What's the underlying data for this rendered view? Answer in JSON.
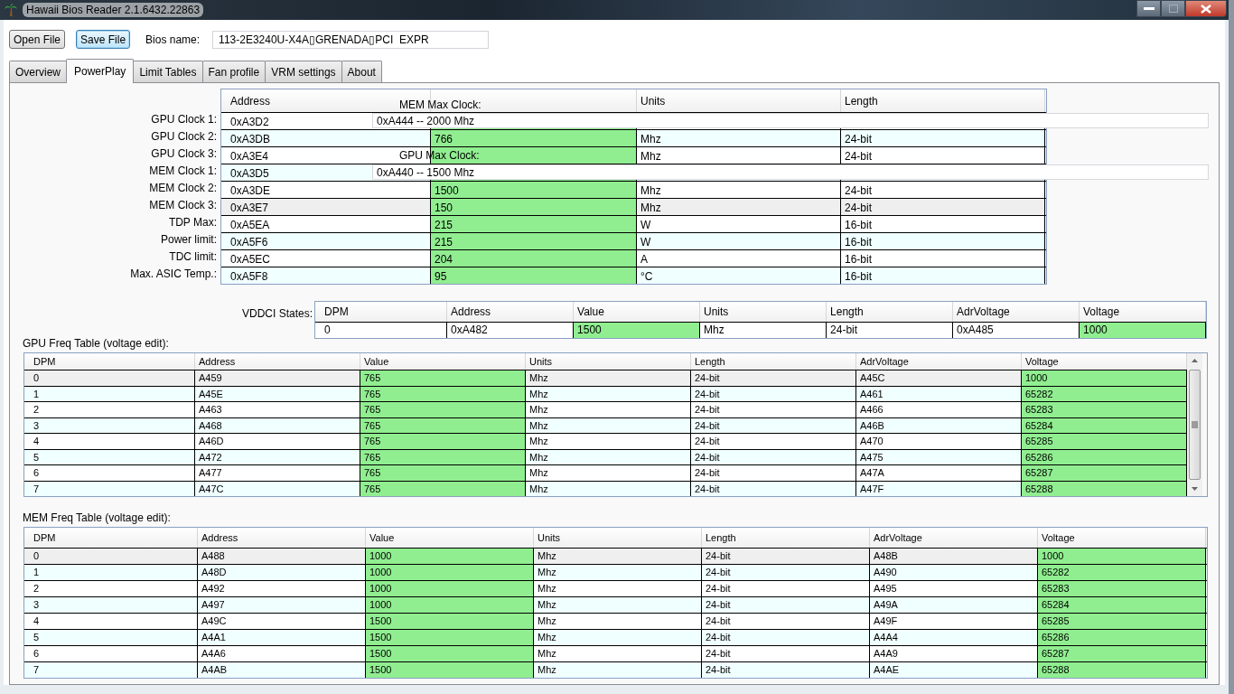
{
  "window": {
    "title": "Hawaii Bios Reader 2.1.6432.22863"
  },
  "toolbar": {
    "buttons": [
      {
        "label": "Open File",
        "focused": false
      },
      {
        "label": "Save File",
        "focused": true
      }
    ],
    "bios_name_label": "Bios name:",
    "bios_name": "113-2E3240U-X4A▯GRENADA▯PCI  EXPR"
  },
  "tabs": [
    {
      "label": "Overview",
      "selected": false
    },
    {
      "label": "PowerPlay",
      "selected": true
    },
    {
      "label": "Limit Tables",
      "selected": false
    },
    {
      "label": "Fan profile",
      "selected": false
    },
    {
      "label": "VRM settings",
      "selected": false
    },
    {
      "label": "About",
      "selected": false
    }
  ],
  "clock_table": {
    "columns": [
      {
        "label": "Address",
        "editable": false
      },
      {
        "editable": true
      },
      {
        "label": "Units",
        "editable": false
      },
      {
        "label": "Length",
        "editable": false
      }
    ],
    "rows": [
      {
        "label": "GPU Clock 1:",
        "selected": false,
        "cells": [
          "0xA3D2",
          null,
          null,
          null
        ]
      },
      {
        "label": "GPU Clock 2:",
        "selected": false,
        "cells": [
          "0xA3DB",
          "766",
          "Mhz",
          "24-bit"
        ]
      },
      {
        "label": "GPU Clock 3:",
        "selected": false,
        "cells": [
          "0xA3E4",
          null,
          "Mhz",
          "24-bit"
        ]
      },
      {
        "label": "MEM Clock 1:",
        "selected": false,
        "cells": [
          "0xA3D5",
          null,
          null,
          null
        ]
      },
      {
        "label": "MEM Clock 2:",
        "selected": false,
        "cells": [
          "0xA3DE",
          "1500",
          "Mhz",
          "24-bit"
        ]
      },
      {
        "label": "MEM Clock 3:",
        "selected": true,
        "cells": [
          "0xA3E7",
          "150",
          "Mhz",
          "24-bit"
        ]
      },
      {
        "label": "TDP Max:",
        "selected": false,
        "cells": [
          "0xA5EA",
          "215",
          "W",
          "16-bit"
        ]
      },
      {
        "label": "Power limit:",
        "selected": false,
        "cells": [
          "0xA5F6",
          "215",
          "W",
          "16-bit"
        ]
      },
      {
        "label": "TDC limit:",
        "selected": false,
        "cells": [
          "0xA5EC",
          "204",
          "A",
          "16-bit"
        ]
      },
      {
        "label": "Max. ASIC Temp.:",
        "selected": false,
        "cells": [
          "0xA5F8",
          "95",
          "°C",
          "16-bit"
        ]
      }
    ]
  },
  "max_clocks": [
    {
      "label": "MEM Max Clock:",
      "value": "0xA444 -- 2000 Mhz"
    },
    {
      "label": "GPU Max Clock:",
      "value": "0xA440 -- 1500 Mhz"
    }
  ],
  "vddci_table": {
    "label": "VDDCI States:",
    "columns": [
      {
        "label": "DPM",
        "editable": false
      },
      {
        "label": "Address",
        "editable": false
      },
      {
        "label": "Value",
        "editable": true
      },
      {
        "label": "Units",
        "editable": false
      },
      {
        "label": "Length",
        "editable": false
      },
      {
        "label": "AdrVoltage",
        "editable": false
      },
      {
        "label": "Voltage",
        "editable": true
      }
    ],
    "rows": [
      {
        "selected": false,
        "cells": [
          "0",
          "0xA482",
          "1500",
          "Mhz",
          "24-bit",
          "0xA485",
          "1000"
        ]
      }
    ]
  },
  "gpu_freq_table": {
    "label": "GPU Freq Table (voltage edit):",
    "columns": [
      {
        "label": "DPM",
        "editable": false
      },
      {
        "label": "Address",
        "editable": false
      },
      {
        "label": "Value",
        "editable": true
      },
      {
        "label": "Units",
        "editable": false
      },
      {
        "label": "Length",
        "editable": false
      },
      {
        "label": "AdrVoltage",
        "editable": false
      },
      {
        "label": "Voltage",
        "editable": true
      }
    ],
    "rows": [
      {
        "selected": true,
        "cells": [
          "0",
          "A459",
          "765",
          "Mhz",
          "24-bit",
          "A45C",
          "1000"
        ]
      },
      {
        "selected": false,
        "cells": [
          "1",
          "A45E",
          "765",
          "Mhz",
          "24-bit",
          "A461",
          "65282"
        ]
      },
      {
        "selected": false,
        "cells": [
          "2",
          "A463",
          "765",
          "Mhz",
          "24-bit",
          "A466",
          "65283"
        ]
      },
      {
        "selected": false,
        "cells": [
          "3",
          "A468",
          "765",
          "Mhz",
          "24-bit",
          "A46B",
          "65284"
        ]
      },
      {
        "selected": false,
        "cells": [
          "4",
          "A46D",
          "765",
          "Mhz",
          "24-bit",
          "A470",
          "65285"
        ]
      },
      {
        "selected": false,
        "cells": [
          "5",
          "A472",
          "765",
          "Mhz",
          "24-bit",
          "A475",
          "65286"
        ]
      },
      {
        "selected": false,
        "cells": [
          "6",
          "A477",
          "765",
          "Mhz",
          "24-bit",
          "A47A",
          "65287"
        ]
      },
      {
        "selected": false,
        "cells": [
          "7",
          "A47C",
          "765",
          "Mhz",
          "24-bit",
          "A47F",
          "65288"
        ]
      }
    ]
  },
  "mem_freq_table": {
    "label": "MEM Freq Table (voltage edit):",
    "columns": [
      {
        "label": "DPM",
        "editable": false
      },
      {
        "label": "Address",
        "editable": false
      },
      {
        "label": "Value",
        "editable": true
      },
      {
        "label": "Units",
        "editable": false
      },
      {
        "label": "Length",
        "editable": false
      },
      {
        "label": "AdrVoltage",
        "editable": false
      },
      {
        "label": "Voltage",
        "editable": true
      }
    ],
    "rows": [
      {
        "selected": true,
        "cells": [
          "0",
          "A488",
          "1000",
          "Mhz",
          "24-bit",
          "A48B",
          "1000"
        ]
      },
      {
        "selected": false,
        "cells": [
          "1",
          "A48D",
          "1000",
          "Mhz",
          "24-bit",
          "A490",
          "65282"
        ]
      },
      {
        "selected": false,
        "cells": [
          "2",
          "A492",
          "1000",
          "Mhz",
          "24-bit",
          "A495",
          "65283"
        ]
      },
      {
        "selected": false,
        "cells": [
          "3",
          "A497",
          "1000",
          "Mhz",
          "24-bit",
          "A49A",
          "65284"
        ]
      },
      {
        "selected": false,
        "cells": [
          "4",
          "A49C",
          "1500",
          "Mhz",
          "24-bit",
          "A49F",
          "65285"
        ]
      },
      {
        "selected": false,
        "cells": [
          "5",
          "A4A1",
          "1500",
          "Mhz",
          "24-bit",
          "A4A4",
          "65286"
        ]
      },
      {
        "selected": false,
        "cells": [
          "6",
          "A4A6",
          "1500",
          "Mhz",
          "24-bit",
          "A4A9",
          "65287"
        ]
      },
      {
        "selected": false,
        "cells": [
          "7",
          "A4AB",
          "1500",
          "Mhz",
          "24-bit",
          "A4AE",
          "65288"
        ]
      }
    ]
  }
}
